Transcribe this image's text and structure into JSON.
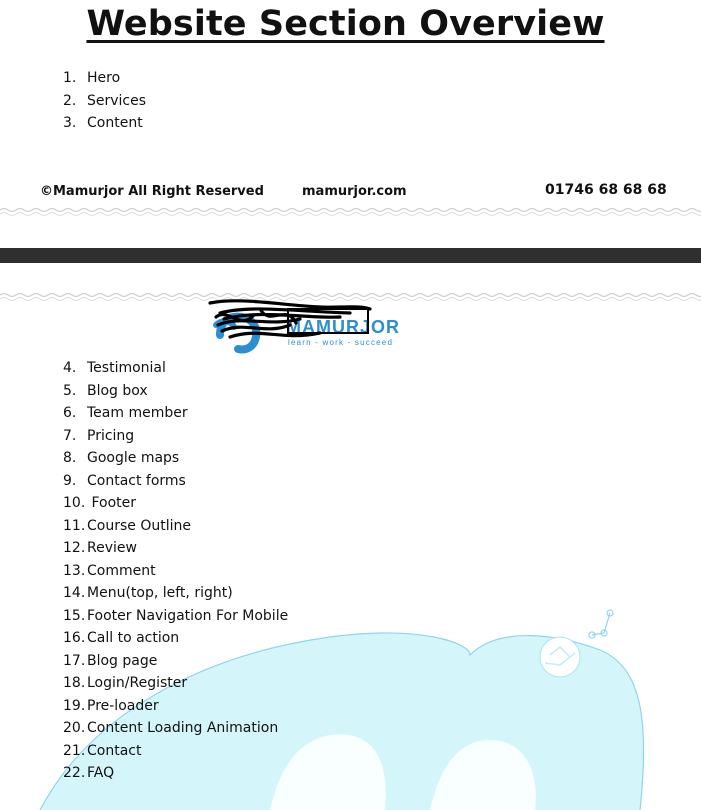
{
  "title": "Website Section Overview",
  "sections_page_1": [
    {
      "num": "1.",
      "label": "Hero"
    },
    {
      "num": "2.",
      "label": "Services"
    },
    {
      "num": "3.",
      "label": "Content"
    }
  ],
  "footer": {
    "copyright": "©Mamurjor All Right Reserved",
    "website": "mamurjor.com",
    "phone": "01746 68 68 68"
  },
  "logo": {
    "name": "MAMURJOR",
    "tagline": "learn - work - succeed",
    "brand_color": "#2b8fd0"
  },
  "sections_page_2": [
    {
      "num": "4.",
      "label": "Testimonial"
    },
    {
      "num": "5.",
      "label": "Blog box"
    },
    {
      "num": "6.",
      "label": "Team member"
    },
    {
      "num": "7.",
      "label": "Pricing"
    },
    {
      "num": "8.",
      "label": "Google maps"
    },
    {
      "num": "9.",
      "label": "Contact forms"
    },
    {
      "num": "10.",
      "label": " Footer"
    },
    {
      "num": "11.",
      "label": "Course Outline"
    },
    {
      "num": "12.",
      "label": "Review"
    },
    {
      "num": "13.",
      "label": "Comment"
    },
    {
      "num": "14.",
      "label": "Menu(top, left, right)"
    },
    {
      "num": "15.",
      "label": "Footer Navigation For Mobile"
    },
    {
      "num": "16.",
      "label": "Call to action"
    },
    {
      "num": "17.",
      "label": "Blog page"
    },
    {
      "num": "18.",
      "label": "Login/Register"
    },
    {
      "num": "19.",
      "label": "Pre-loader"
    },
    {
      "num": "20.",
      "label": "Content Loading Animation"
    },
    {
      "num": "21.",
      "label": "Contact"
    },
    {
      "num": "22.",
      "label": "FAQ"
    }
  ],
  "colors": {
    "page_gap": "#2f2f2f",
    "watermark": "#d4f6fb",
    "watermark_stroke": "#8fd6e8"
  }
}
